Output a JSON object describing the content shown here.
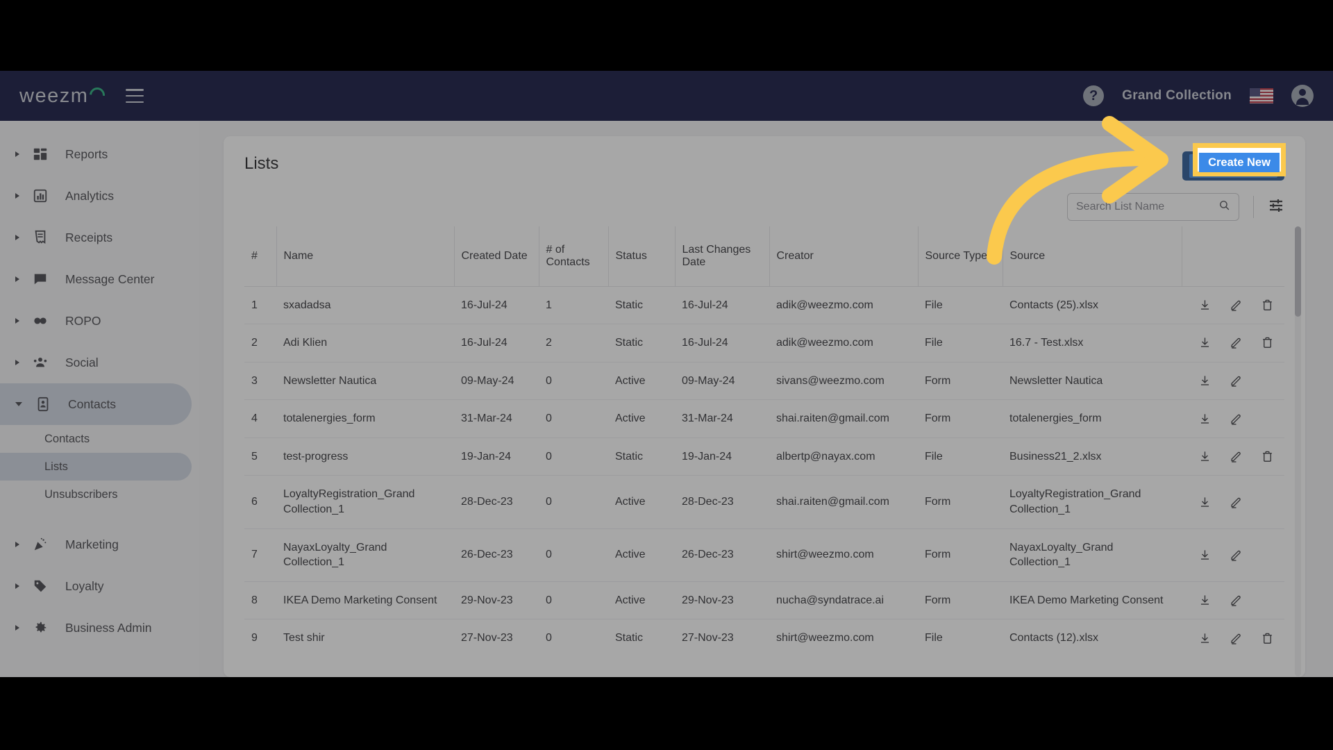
{
  "topbar": {
    "logo_text": "weezm",
    "logo_icon": "weezmo-logo",
    "menu_icon": "hamburger-menu-icon",
    "help_icon": "help-circle-icon",
    "help_glyph": "?",
    "account_name": "Grand Collection",
    "flag_icon": "us-flag-icon",
    "avatar_icon": "account-avatar-icon"
  },
  "sidebar": {
    "items": [
      {
        "label": "Reports",
        "icon": "dashboard-icon",
        "expanded": false
      },
      {
        "label": "Analytics",
        "icon": "bar-chart-icon",
        "expanded": false
      },
      {
        "label": "Receipts",
        "icon": "receipt-icon",
        "expanded": false
      },
      {
        "label": "Message Center",
        "icon": "chat-bubble-icon",
        "expanded": false
      },
      {
        "label": "ROPO",
        "icon": "infinity-icon",
        "expanded": false
      },
      {
        "label": "Social",
        "icon": "people-group-icon",
        "expanded": false
      },
      {
        "label": "Contacts",
        "icon": "contact-card-icon",
        "expanded": true
      },
      {
        "label": "Marketing",
        "icon": "party-popper-icon",
        "expanded": false
      },
      {
        "label": "Loyalty",
        "icon": "price-tag-icon",
        "expanded": false
      },
      {
        "label": "Business Admin",
        "icon": "gear-icon",
        "expanded": false
      }
    ],
    "contacts_children": [
      {
        "label": "Contacts",
        "active": false
      },
      {
        "label": "Lists",
        "active": true
      },
      {
        "label": "Unsubscribers",
        "active": false
      }
    ]
  },
  "main": {
    "title": "Lists",
    "create_button_label": "Create New",
    "search_placeholder": "Search List Name",
    "search_value": "",
    "search_icon": "search-icon",
    "filter_icon": "filter-sliders-icon",
    "columns": [
      "#",
      "Name",
      "Created Date",
      "# of Contacts",
      "Status",
      "Last Changes Date",
      "Creator",
      "Source Type",
      "Source",
      ""
    ],
    "rows": [
      {
        "num": "1",
        "name": "sxadadsa",
        "created": "16-Jul-24",
        "contacts": "1",
        "status": "Static",
        "changed": "16-Jul-24",
        "creator": "adik@weezmo.com",
        "source_type": "File",
        "source": "Contacts (25).xlsx",
        "can_delete": true
      },
      {
        "num": "2",
        "name": "Adi Klien",
        "created": "16-Jul-24",
        "contacts": "2",
        "status": "Static",
        "changed": "16-Jul-24",
        "creator": "adik@weezmo.com",
        "source_type": "File",
        "source": "16.7 - Test.xlsx",
        "can_delete": true
      },
      {
        "num": "3",
        "name": "Newsletter Nautica",
        "created": "09-May-24",
        "contacts": "0",
        "status": "Active",
        "changed": "09-May-24",
        "creator": "sivans@weezmo.com",
        "source_type": "Form",
        "source": "Newsletter Nautica",
        "can_delete": false
      },
      {
        "num": "4",
        "name": "totalenergies_form",
        "created": "31-Mar-24",
        "contacts": "0",
        "status": "Active",
        "changed": "31-Mar-24",
        "creator": "shai.raiten@gmail.com",
        "source_type": "Form",
        "source": "totalenergies_form",
        "can_delete": false
      },
      {
        "num": "5",
        "name": "test-progress",
        "created": "19-Jan-24",
        "contacts": "0",
        "status": "Static",
        "changed": "19-Jan-24",
        "creator": "albertp@nayax.com",
        "source_type": "File",
        "source": "Business21_2.xlsx",
        "can_delete": true
      },
      {
        "num": "6",
        "name": "LoyaltyRegistration_Grand Collection_1",
        "created": "28-Dec-23",
        "contacts": "0",
        "status": "Active",
        "changed": "28-Dec-23",
        "creator": "shai.raiten@gmail.com",
        "source_type": "Form",
        "source": "LoyaltyRegistration_Grand Collection_1",
        "can_delete": false
      },
      {
        "num": "7",
        "name": "NayaxLoyalty_Grand Collection_1",
        "created": "26-Dec-23",
        "contacts": "0",
        "status": "Active",
        "changed": "26-Dec-23",
        "creator": "shirt@weezmo.com",
        "source_type": "Form",
        "source": "NayaxLoyalty_Grand Collection_1",
        "can_delete": false
      },
      {
        "num": "8",
        "name": "IKEA Demo Marketing Consent",
        "created": "29-Nov-23",
        "contacts": "0",
        "status": "Active",
        "changed": "29-Nov-23",
        "creator": "nucha@syndatrace.ai",
        "source_type": "Form",
        "source": "IKEA Demo Marketing Consent",
        "can_delete": false
      },
      {
        "num": "9",
        "name": "Test shir",
        "created": "27-Nov-23",
        "contacts": "0",
        "status": "Static",
        "changed": "27-Nov-23",
        "creator": "shirt@weezmo.com",
        "source_type": "File",
        "source": "Contacts (12).xlsx",
        "can_delete": true
      }
    ],
    "row_action_icons": [
      "download-icon",
      "edit-pencil-icon",
      "delete-trash-icon"
    ]
  },
  "annotation": {
    "highlight_target": "Create New",
    "highlight_color": "#FBC94D",
    "arrow_color": "#FBC94D",
    "arrow_icon": "curved-arrow-right-icon"
  },
  "colors": {
    "topbar_bg": "#030633",
    "accent_blue": "#3b8ae8",
    "accent_blue_dark": "#1d4f91",
    "logo_green": "#19a974",
    "sidebar_active": "#cdd3e0",
    "highlight_yellow": "#FBC94D"
  }
}
